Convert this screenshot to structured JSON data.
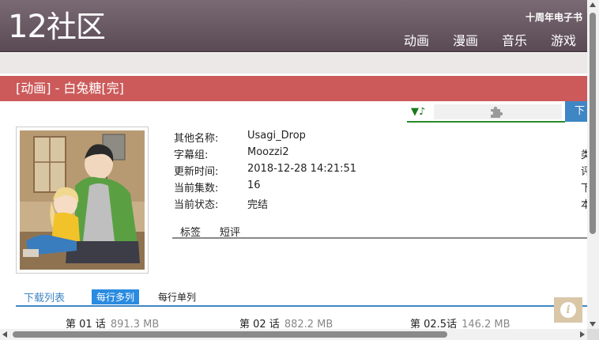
{
  "header": {
    "logo_number": "12",
    "logo_text": "社区",
    "anniversary": "十周年电子书",
    "nav": [
      "动画",
      "漫画",
      "音乐",
      "游戏"
    ]
  },
  "title": "[动画] - 白兔糖[完]",
  "player": {
    "note_icon": "music-note-icon",
    "plugin_icon": "puzzle-piece-icon",
    "download_label": "下"
  },
  "info": [
    {
      "label": "其他名称:",
      "value": "Usagi_Drop",
      "right": "类"
    },
    {
      "label": "字幕组:",
      "value": "Moozzi2",
      "right": "评"
    },
    {
      "label": "更新时间:",
      "value": "2018-12-28 14:21:51",
      "right": "下"
    },
    {
      "label": "当前集数:",
      "value": "16",
      "right": "本"
    },
    {
      "label": "当前状态:",
      "value": "完结",
      "right": ""
    }
  ],
  "sub_tabs": [
    "标签",
    "短评"
  ],
  "download_list": {
    "title": "下载列表",
    "multi_label": "每行多列",
    "single_label": "每行单列"
  },
  "episodes": [
    {
      "name": "第 01 话",
      "size": "891.3 MB"
    },
    {
      "name": "第 02 话",
      "size": "882.2 MB"
    },
    {
      "name": "第 02.5话",
      "size": "146.2 MB"
    }
  ],
  "float_info_icon": "info-icon",
  "colors": {
    "header": "#6a5a63",
    "title_bar": "#cc5a5a",
    "accent_blue": "#3f86c4",
    "player_green": "#2a8a2a",
    "info_float": "#d9c7a8"
  }
}
